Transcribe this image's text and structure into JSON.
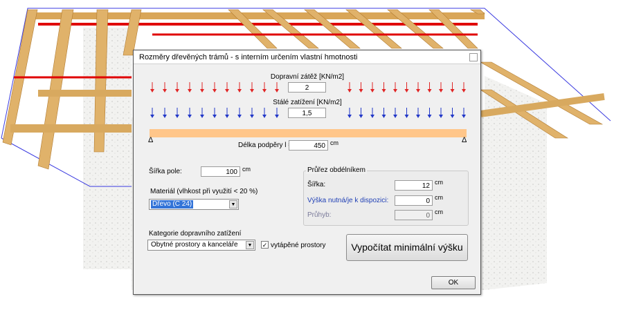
{
  "dialog": {
    "title": "Rozměry dřevěných trámů - s interním určením vlastní hmotnosti"
  },
  "loads": {
    "traffic_label": "Dopravní zátěž [KN/m2]",
    "traffic_value": "2",
    "traffic_color": "#e02424",
    "permanent_label": "Stálé zatížení [KN/m2]",
    "permanent_value": "1,5",
    "permanent_color": "#2238c8",
    "arrows_per_side": 11
  },
  "beam": {
    "length_label": "Délka podpěry l =",
    "length_value": "450",
    "length_unit": "cm",
    "support_symbol": "Δ",
    "color": "#ffc68a"
  },
  "field_width": {
    "label": "Šířka pole:",
    "value": "100",
    "unit": "cm"
  },
  "material": {
    "label": "Materiál (vlhkost při využití < 20 %)",
    "selected": "Dřevo (C 24)"
  },
  "cross_section": {
    "group_title": "Průřez obdélníkem",
    "width_label": "Šířka:",
    "width_value": "12",
    "width_unit": "cm",
    "height_label": "Výška nutná/je k dispozici:",
    "height_value": "0",
    "height_unit": "cm",
    "deflection_label": "Průhyb:",
    "deflection_value": "0",
    "deflection_unit": "cm"
  },
  "traffic_category": {
    "label": "Kategorie dopravního zatížení",
    "selected": "Obytné prostory a kanceláře",
    "heated_checked": true,
    "heated_label": "vytápěné prostory"
  },
  "buttons": {
    "calculate_label": "Vypočítat minimální výšku",
    "ok_label": "OK"
  },
  "icons": {
    "dropdown": "chevron-down-icon",
    "check": "checkmark-icon",
    "support": "triangle-support-icon"
  }
}
